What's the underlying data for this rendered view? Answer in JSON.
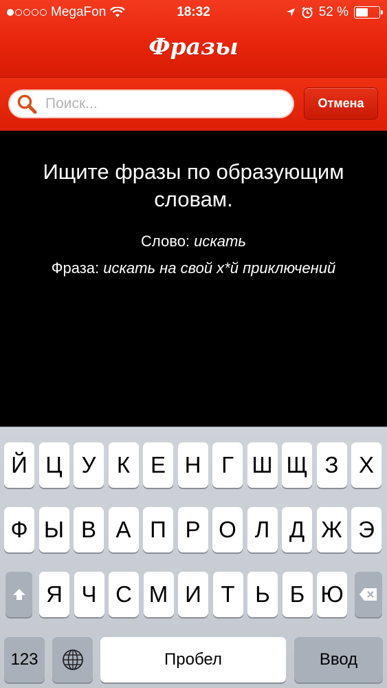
{
  "status_bar": {
    "carrier": "MegaFon",
    "time": "18:32",
    "battery_percent": "52 %",
    "battery_level": 0.52,
    "signal_bars_filled": 1,
    "signal_bars_total": 5,
    "icons": [
      "wifi-icon",
      "location-arrow-icon",
      "alarm-icon",
      "battery-icon"
    ]
  },
  "nav": {
    "title": "Фразы"
  },
  "search": {
    "placeholder": "Поиск...",
    "cancel_label": "Отмена"
  },
  "content": {
    "headline": "Ищите фразы по образующим словам.",
    "word_label": "Слово:",
    "word_example": "искать",
    "phrase_label": "Фраза:",
    "phrase_example": "искать на свой х*й приключений"
  },
  "keyboard": {
    "row1": [
      "Й",
      "Ц",
      "У",
      "К",
      "Е",
      "Н",
      "Г",
      "Ш",
      "Щ",
      "З",
      "Х"
    ],
    "row2": [
      "Ф",
      "Ы",
      "В",
      "А",
      "П",
      "Р",
      "О",
      "Л",
      "Д",
      "Ж",
      "Э"
    ],
    "row3": [
      "Я",
      "Ч",
      "С",
      "М",
      "И",
      "Т",
      "Ь",
      "Б",
      "Ю"
    ],
    "numbers_label": "123",
    "space_label": "Пробел",
    "return_label": "Ввод"
  },
  "colors": {
    "accent": "#e8250c",
    "keyboard_bg": "#c9cdd3"
  }
}
